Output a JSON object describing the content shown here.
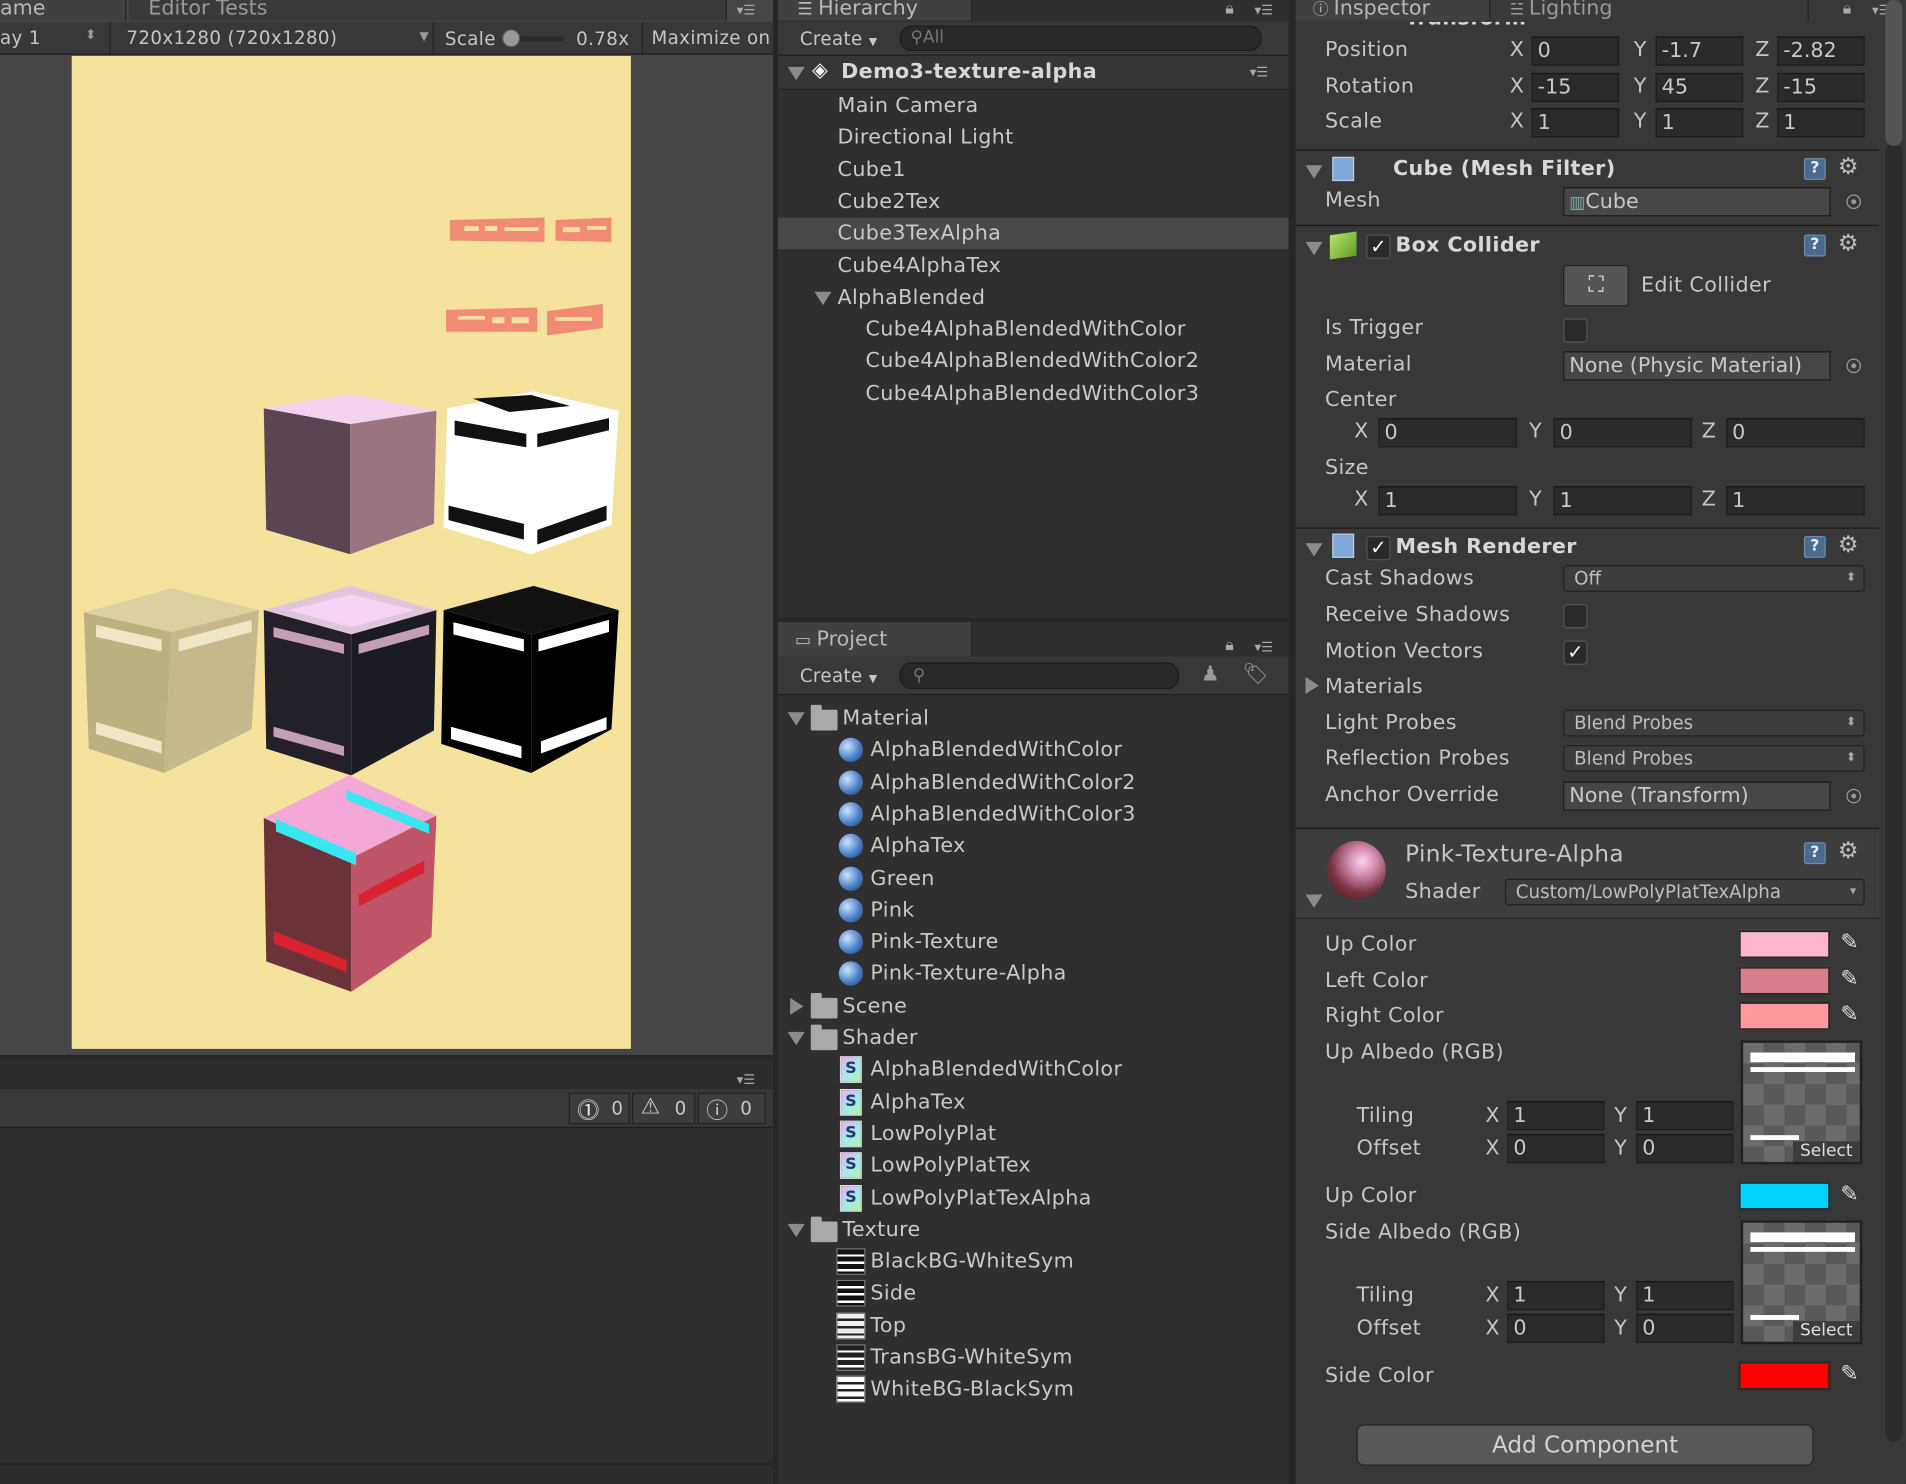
{
  "game": {
    "tab_game": "ame",
    "tab_editor_tests": "Editor Tests",
    "display": "ay 1",
    "resolution": "720x1280 (720x1280)",
    "scale_label": "Scale",
    "scale_value": "0.78x",
    "scale_level": 0.1,
    "maximize": "Maximize on",
    "bg_color": "#f5e39d"
  },
  "console": {
    "errors": "0",
    "warnings": "0",
    "messages": "0"
  },
  "hierarchy": {
    "tab": "Hierarchy",
    "create": "Create",
    "search_placeholder": "All",
    "scene": "Demo3-texture-alpha",
    "items": [
      "Main Camera",
      "Directional Light",
      "Cube1",
      "Cube2Tex",
      "Cube3TexAlpha",
      "Cube4AlphaTex",
      "AlphaBlended"
    ],
    "children": [
      "Cube4AlphaBlendedWithColor",
      "Cube4AlphaBlendedWithColor2",
      "Cube4AlphaBlendedWithColor3"
    ],
    "selected_index": 4
  },
  "project": {
    "tab": "Project",
    "create": "Create",
    "folders": {
      "material": "Material",
      "scene": "Scene",
      "shader": "Shader",
      "texture": "Texture"
    },
    "materials": [
      "AlphaBlendedWithColor",
      "AlphaBlendedWithColor2",
      "AlphaBlendedWithColor3",
      "AlphaTex",
      "Green",
      "Pink",
      "Pink-Texture",
      "Pink-Texture-Alpha"
    ],
    "shaders": [
      "AlphaBlendedWithColor",
      "AlphaTex",
      "LowPolyPlat",
      "LowPolyPlatTex",
      "LowPolyPlatTexAlpha"
    ],
    "textures": [
      "BlackBG-WhiteSym",
      "Side",
      "Top",
      "TransBG-WhiteSym",
      "WhiteBG-BlackSym"
    ]
  },
  "inspector": {
    "tab": "Inspector",
    "tab_lighting": "Lighting",
    "transform_header": "Transform",
    "position": {
      "label": "Position",
      "x": "0",
      "y": "-1.7",
      "z": "-2.82"
    },
    "rotation": {
      "label": "Rotation",
      "x": "-15",
      "y": "45",
      "z": "-15"
    },
    "scale": {
      "label": "Scale",
      "x": "1",
      "y": "1",
      "z": "1"
    },
    "axis_x": "X",
    "axis_y": "Y",
    "axis_z": "Z",
    "mesh_filter": {
      "title": "Cube (Mesh Filter)",
      "mesh_label": "Mesh",
      "mesh_value": "Cube"
    },
    "box_collider": {
      "title": "Box Collider",
      "edit_collider": "Edit Collider",
      "is_trigger": "Is Trigger",
      "material": "Material",
      "material_value": "None (Physic Material)",
      "center": "Center",
      "center_x": "0",
      "center_y": "0",
      "center_z": "0",
      "size": "Size",
      "size_x": "1",
      "size_y": "1",
      "size_z": "1"
    },
    "mesh_renderer": {
      "title": "Mesh Renderer",
      "cast_shadows": "Cast Shadows",
      "cast_shadows_value": "Off",
      "receive_shadows": "Receive Shadows",
      "motion_vectors": "Motion Vectors",
      "materials": "Materials",
      "light_probes": "Light Probes",
      "light_probes_value": "Blend Probes",
      "reflection_probes": "Reflection Probes",
      "reflection_probes_value": "Blend Probes",
      "anchor_override": "Anchor Override",
      "anchor_override_value": "None (Transform)"
    },
    "material": {
      "name": "Pink-Texture-Alpha",
      "shader_label": "Shader",
      "shader_value": "Custom/LowPolyPlatTexAlpha",
      "up_color": "Up Color",
      "left_color": "Left Color",
      "right_color": "Right Color",
      "up_albedo": "Up Albedo (RGB)",
      "tiling": "Tiling",
      "offset": "Offset",
      "up_tiling_x": "1",
      "up_tiling_y": "1",
      "up_offset_x": "0",
      "up_offset_y": "0",
      "up_color2": "Up Color",
      "side_albedo": "Side Albedo (RGB)",
      "side_tiling_x": "1",
      "side_tiling_y": "1",
      "side_offset_x": "0",
      "side_offset_y": "0",
      "side_color": "Side Color",
      "select": "Select",
      "colors": {
        "up": "#ffb6c9",
        "left": "#d47f89",
        "right": "#ff9aa0",
        "up2": "#00d4ff",
        "side": "#ff0000"
      }
    },
    "add_component": "Add Component"
  }
}
